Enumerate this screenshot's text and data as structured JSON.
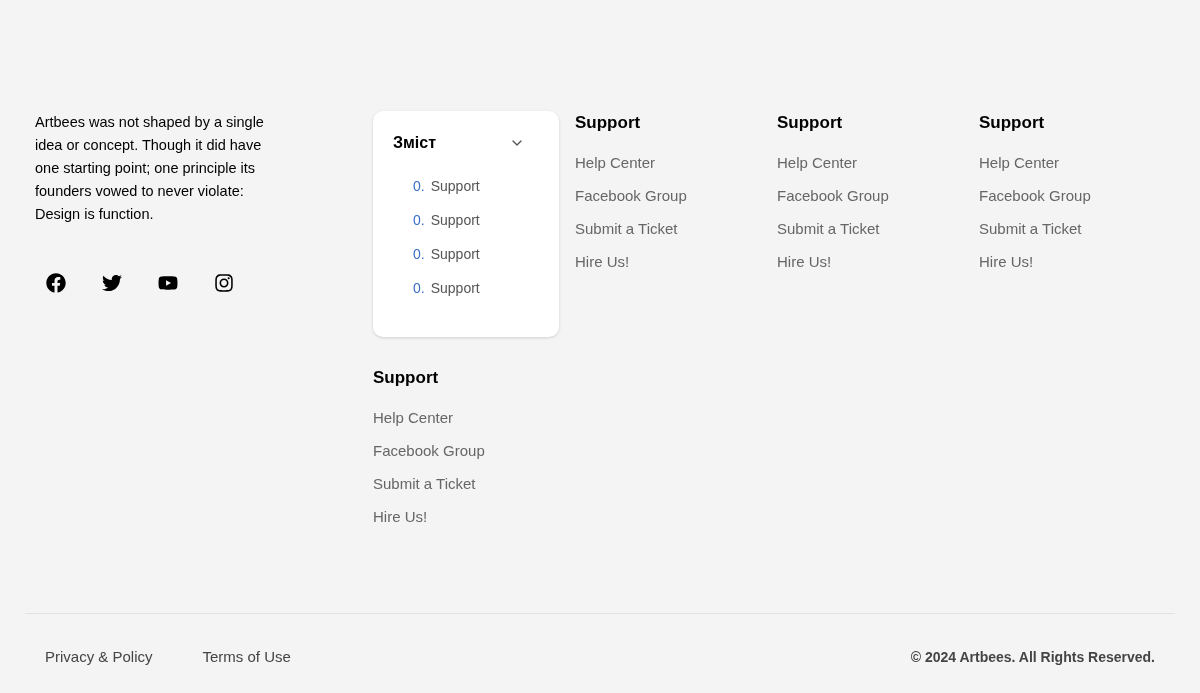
{
  "about": {
    "text": "Artbees was not shaped by a single idea or concept. Though it did have one starting point; one principle its founders vowed to never violate: Design is function."
  },
  "social": [
    {
      "kind": "facebook"
    },
    {
      "kind": "twitter"
    },
    {
      "kind": "youtube"
    },
    {
      "kind": "instagram"
    }
  ],
  "toc": {
    "title": "Зміст",
    "expanded": true,
    "items": [
      {
        "number": "0.",
        "label": "Support"
      },
      {
        "number": "0.",
        "label": "Support"
      },
      {
        "number": "0.",
        "label": "Support"
      },
      {
        "number": "0.",
        "label": "Support"
      }
    ]
  },
  "columns": [
    {
      "heading": "Support",
      "links": [
        "Help Center",
        "Facebook Group",
        "Submit a Ticket",
        "Hire Us!"
      ]
    },
    {
      "heading": "Support",
      "links": [
        "Help Center",
        "Facebook Group",
        "Submit a Ticket",
        "Hire Us!"
      ]
    },
    {
      "heading": "Support",
      "links": [
        "Help Center",
        "Facebook Group",
        "Submit a Ticket",
        "Hire Us!"
      ]
    },
    {
      "heading": "Support",
      "links": [
        "Help Center",
        "Facebook Group",
        "Submit a Ticket",
        "Hire Us!"
      ]
    }
  ],
  "bottom": {
    "links": [
      "Privacy & Policy",
      "Terms of Use"
    ],
    "copyright": "© 2024 Artbees. All Rights Reserved."
  }
}
